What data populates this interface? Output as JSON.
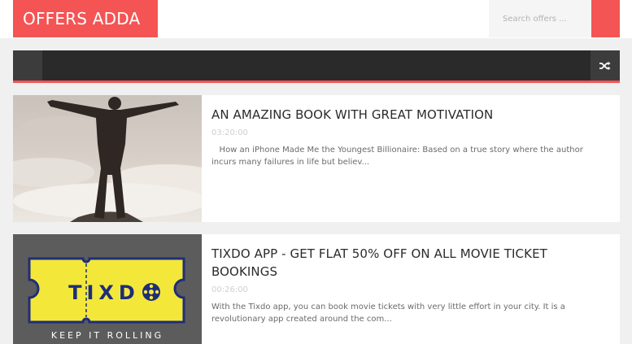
{
  "header": {
    "logo": "OFFERS ADDA",
    "search_placeholder": "Search offers ...",
    "search_icon": "search-icon"
  },
  "nav": {
    "menu_icon": "menu-icon",
    "random_icon": "shuffle-icon"
  },
  "posts": [
    {
      "title": "AN AMAZING BOOK WITH GREAT MOTIVATION",
      "time": "03:20:00",
      "excerpt": "How an iPhone Made Me the Youngest Billionaire: Based on a true story where the author incurs many failures in life but believ..."
    },
    {
      "title": "TIXDO APP - GET FLAT 50% OFF ON ALL MOVIE TICKET BOOKINGS",
      "time": "00:26:00",
      "excerpt": "With the Tixdo app, you can book movie tickets with very little effort in your city. It is a revolutionary app created around the com...",
      "thumb_logo": "TIXDO",
      "thumb_tagline": "KEEP IT ROLLING"
    }
  ],
  "colors": {
    "accent": "#f45454",
    "nav_bg": "#2a2a2a",
    "page_bg": "#f0f0f0"
  }
}
